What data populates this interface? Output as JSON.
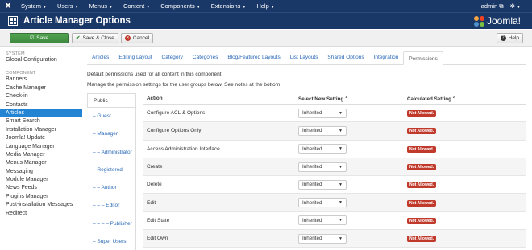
{
  "topnav": {
    "menus": [
      {
        "label": "System"
      },
      {
        "label": "Users"
      },
      {
        "label": "Menus"
      },
      {
        "label": "Content"
      },
      {
        "label": "Components"
      },
      {
        "label": "Extensions"
      },
      {
        "label": "Help"
      }
    ],
    "user_label": "admin",
    "external_icon": "external-link-icon",
    "settings_icon": "gear-icon"
  },
  "header": {
    "title": "Article Manager Options",
    "brand": "Joomla!",
    "title_icon": "grid-icon"
  },
  "toolbar": {
    "save_label": "Save",
    "save_close_label": "Save & Close",
    "cancel_label": "Cancel",
    "help_label": "Help"
  },
  "sidebar": {
    "system_heading": "SYSTEM",
    "system_items": [
      "Global Configuration"
    ],
    "component_heading": "COMPONENT",
    "component_items": [
      "Banners",
      "Cache Manager",
      "Check-in",
      "Contacts",
      "Articles",
      "Smart Search",
      "Installation Manager",
      "Joomla! Update",
      "Language Manager",
      "Media Manager",
      "Menus Manager",
      "Messaging",
      "Module Manager",
      "News Feeds",
      "Plugins Manager",
      "Post-installation Messages",
      "Redirect"
    ],
    "active_item": "Articles"
  },
  "tabs": [
    {
      "label": "Articles"
    },
    {
      "label": "Editing Layout"
    },
    {
      "label": "Category"
    },
    {
      "label": "Categories"
    },
    {
      "label": "Blog/Featured Layouts"
    },
    {
      "label": "List Layouts"
    },
    {
      "label": "Shared Options"
    },
    {
      "label": "Integration"
    },
    {
      "label": "Permissions"
    }
  ],
  "active_tab": "Permissions",
  "descriptions": {
    "line1": "Default permissions used for all content in this component.",
    "line2": "Manage the permission settings for the user groups below. See notes at the bottom"
  },
  "groups": [
    "Public",
    "– Guest",
    "– Manager",
    "– – Administrator",
    "– Registered",
    "– – Author",
    "– – – Editor",
    "– – – – Publisher",
    "– Super Users"
  ],
  "table": {
    "headers": {
      "action": "Action",
      "select": "Select New Setting",
      "select_note": "1",
      "calculated": "Calculated Setting",
      "calculated_note": "2"
    },
    "rows": [
      {
        "action": "Configure ACL & Options",
        "setting": "Inherited",
        "calculated": "Not Allowed."
      },
      {
        "action": "Configure Options Only",
        "setting": "Inherited",
        "calculated": "Not Allowed."
      },
      {
        "action": "Access Administration Interface",
        "setting": "Inherited",
        "calculated": "Not Allowed."
      },
      {
        "action": "Create",
        "setting": "Inherited",
        "calculated": "Not Allowed."
      },
      {
        "action": "Delete",
        "setting": "Inherited",
        "calculated": "Not Allowed."
      },
      {
        "action": "Edit",
        "setting": "Inherited",
        "calculated": "Not Allowed."
      },
      {
        "action": "Edit State",
        "setting": "Inherited",
        "calculated": "Not Allowed."
      },
      {
        "action": "Edit Own",
        "setting": "Inherited",
        "calculated": "Not Allowed."
      }
    ]
  },
  "colors": {
    "nav_bg": "#1a3867",
    "save_green": "#46964a",
    "active_blue": "#2384d3",
    "link_blue": "#2a69b8",
    "not_allowed_red": "#c0392b"
  }
}
